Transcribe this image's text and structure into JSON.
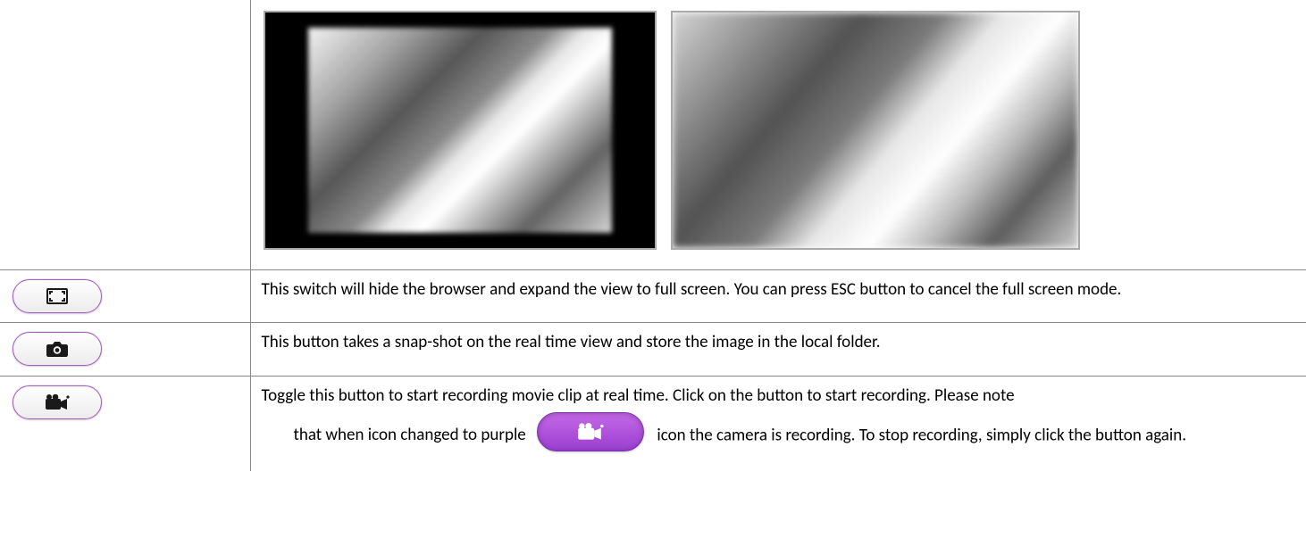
{
  "rows": {
    "screenshots": {
      "alt_dark": "Normal view screenshot",
      "alt_light": "Full screen view screenshot"
    },
    "fullscreen": {
      "icon": "fullscreen-icon",
      "description": "This switch will hide the browser and expand the view to full screen. You can press ESC button to cancel the full screen mode."
    },
    "snapshot": {
      "icon": "camera-icon",
      "description": "This button takes a snap-shot on the real time view and store the image in the local folder."
    },
    "record": {
      "icon": "video-camera-icon",
      "line1": "Toggle this button to start recording movie clip at real time. Click on the button to start recording. Please note",
      "before_inline_prefix": "that when icon changed to purple",
      "after_inline": "icon the camera is recording. To stop recording, simply click the button again.",
      "active_icon": "video-camera-recording-icon"
    }
  }
}
